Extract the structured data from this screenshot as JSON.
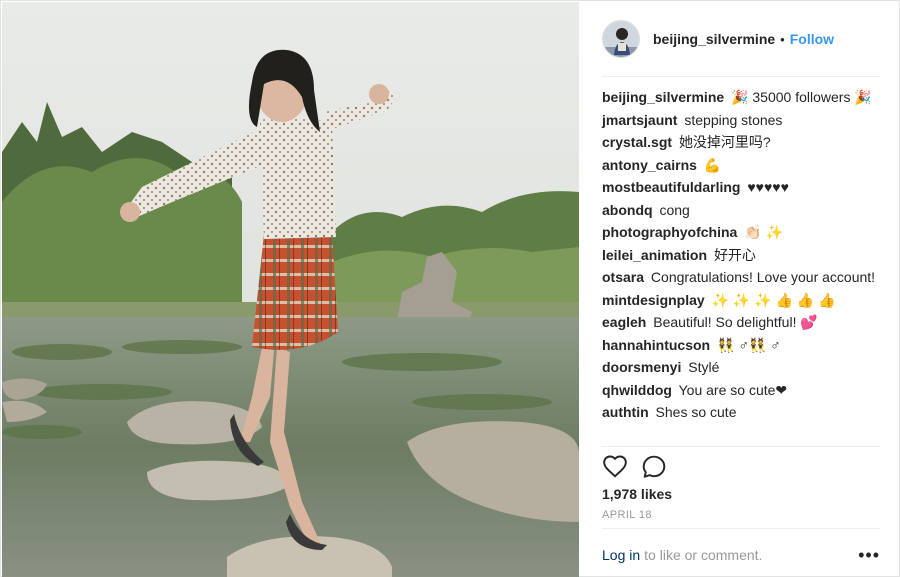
{
  "post": {
    "username": "beijing_silvermine",
    "separator": "•",
    "follow_label": "Follow"
  },
  "comments": [
    {
      "user": "beijing_silvermine",
      "text": "🎉  35000 followers 🎉"
    },
    {
      "user": "jmartsjaunt",
      "text": "stepping stones"
    },
    {
      "user": "crystal.sgt",
      "text": "她没掉河里吗?"
    },
    {
      "user": "antony_cairns",
      "text": "💪"
    },
    {
      "user": "mostbeautifuldarling",
      "text": "♥♥♥♥♥"
    },
    {
      "user": "abondq",
      "text": "cong"
    },
    {
      "user": "photographyofchina",
      "text": "👏🏻 ✨"
    },
    {
      "user": "leilei_animation",
      "text": "好开心"
    },
    {
      "user": "otsara",
      "text": "Congratulations! Love your account!"
    },
    {
      "user": "mintdesignplay",
      "text": "✨ ✨ ✨ 👍 👍 👍"
    },
    {
      "user": "eagleh",
      "text": "Beautiful! So delightful! 💕"
    },
    {
      "user": "hannahintucson",
      "text": "👯 ♂👯 ♂"
    },
    {
      "user": "doorsmenyi",
      "text": "Stylé"
    },
    {
      "user": "qhwilddog",
      "text": "You are so cute❤"
    },
    {
      "user": "authtin",
      "text": "Shes so cute"
    }
  ],
  "actions": {
    "like_icon": "heart-icon",
    "comment_icon": "speech-bubble-icon"
  },
  "stats": {
    "likes": "1,978 likes",
    "date": "APRIL 18"
  },
  "footer": {
    "login_label": "Log in",
    "login_suffix": "to like or comment.",
    "more_label": "•••"
  }
}
